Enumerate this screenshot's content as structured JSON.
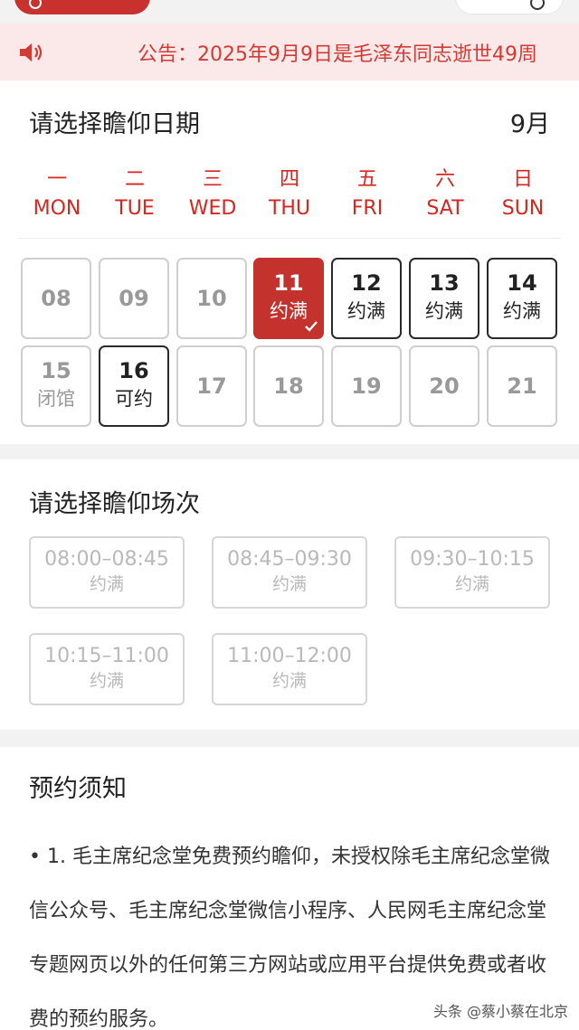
{
  "notice": {
    "text": "公告：2025年9月9日是毛泽东同志逝世49周"
  },
  "date_section": {
    "title": "请选择瞻仰日期",
    "month": "9月",
    "weekdays": [
      {
        "cn": "一",
        "en": "MON"
      },
      {
        "cn": "二",
        "en": "TUE"
      },
      {
        "cn": "三",
        "en": "WED"
      },
      {
        "cn": "四",
        "en": "THU"
      },
      {
        "cn": "五",
        "en": "FRI"
      },
      {
        "cn": "六",
        "en": "SAT"
      },
      {
        "cn": "日",
        "en": "SUN"
      }
    ],
    "days": [
      {
        "num": "08",
        "status": ""
      },
      {
        "num": "09",
        "status": ""
      },
      {
        "num": "10",
        "status": ""
      },
      {
        "num": "11",
        "status": "约满"
      },
      {
        "num": "12",
        "status": "约满"
      },
      {
        "num": "13",
        "status": "约满"
      },
      {
        "num": "14",
        "status": "约满"
      },
      {
        "num": "15",
        "status": "闭馆"
      },
      {
        "num": "16",
        "status": "可约"
      },
      {
        "num": "17",
        "status": ""
      },
      {
        "num": "18",
        "status": ""
      },
      {
        "num": "19",
        "status": ""
      },
      {
        "num": "20",
        "status": ""
      },
      {
        "num": "21",
        "status": ""
      }
    ],
    "selected_day": "11"
  },
  "slot_section": {
    "title": "请选择瞻仰场次",
    "slots": [
      {
        "time": "08:00–08:45",
        "status": "约满"
      },
      {
        "time": "08:45–09:30",
        "status": "约满"
      },
      {
        "time": "09:30–10:15",
        "status": "约满"
      },
      {
        "time": "10:15–11:00",
        "status": "约满"
      },
      {
        "time": "11:00–12:00",
        "status": "约满"
      }
    ]
  },
  "notes": {
    "title": "预约须知",
    "text": "• 1.  毛主席纪念堂免费预约瞻仰，未授权除毛主席纪念堂微信公众号、毛主席纪念堂微信小程序、人民网毛主席纪念堂专题网页以外的任何第三方网站或应用平台提供免费或者收费的预约服务。"
  },
  "watermark": "头条 @蔡小蔡在北京",
  "colors": {
    "accent": "#c3322c",
    "notice_bg": "#fbe9e9",
    "notice_text": "#d33a33"
  }
}
